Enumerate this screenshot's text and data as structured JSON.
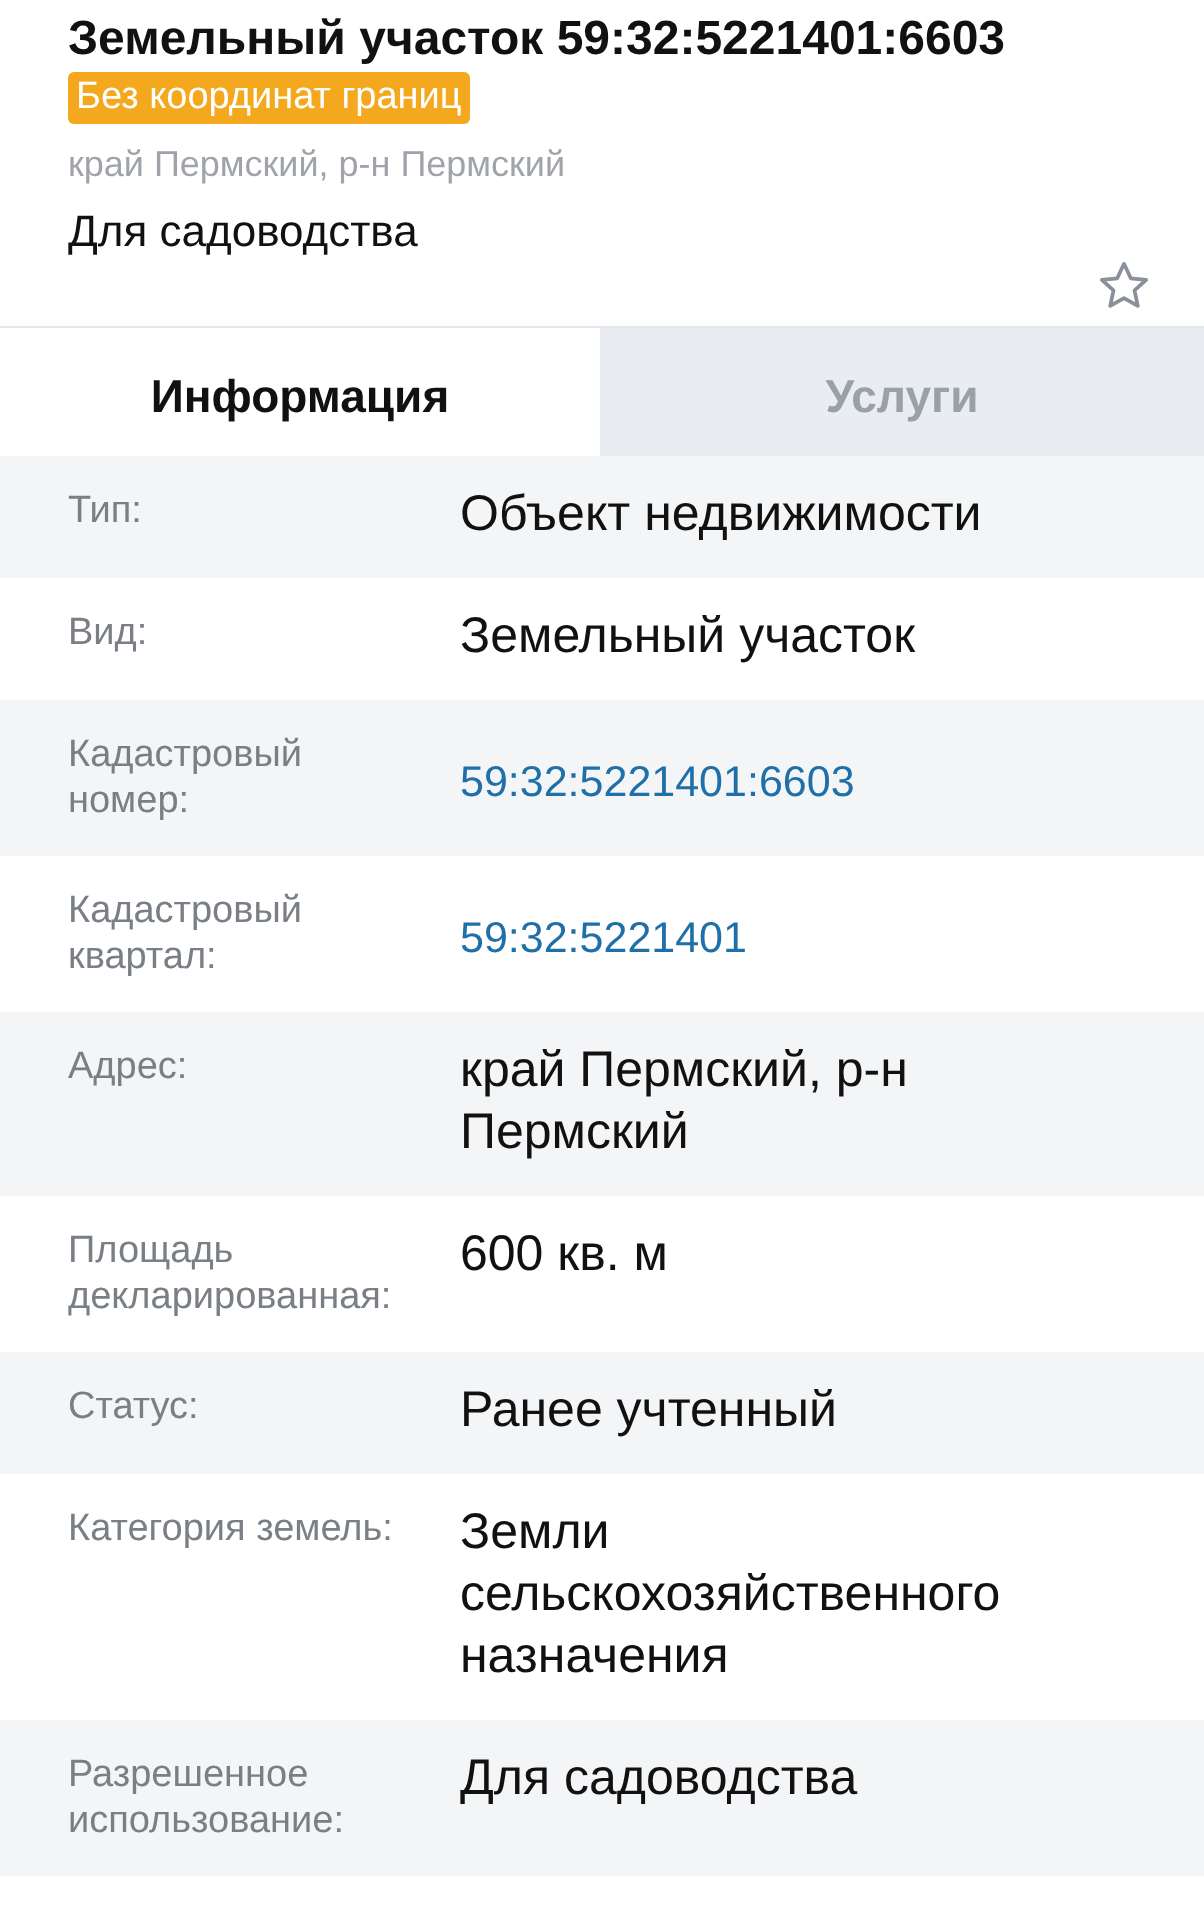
{
  "header": {
    "title": "Земельный участок 59:32:5221401:6603",
    "badge": "Без координат границ",
    "address": "край Пермский, р-н Пермский",
    "purpose": "Для садоводства",
    "favorite": false
  },
  "tabs": [
    {
      "label": "Информация",
      "selected": true
    },
    {
      "label": "Услуги",
      "selected": false
    }
  ],
  "rows": [
    {
      "label": "Тип:",
      "value": "Объект недвижимости",
      "kind": "text"
    },
    {
      "label": "Вид:",
      "value": "Земельный участок",
      "kind": "text"
    },
    {
      "label": "Кадастровый номер:",
      "value": "59:32:5221401:6603",
      "kind": "link"
    },
    {
      "label": "Кадастровый квартал:",
      "value": "59:32:5221401",
      "kind": "link"
    },
    {
      "label": "Адрес:",
      "value": "край Пермский, р-н Пермский",
      "kind": "text"
    },
    {
      "label": "Площадь декларированная:",
      "value": "600 кв. м",
      "kind": "text"
    },
    {
      "label": "Статус:",
      "value": "Ранее учтенный",
      "kind": "text"
    },
    {
      "label": "Категория земель:",
      "value": "Земли сельскохозяйственного назначения",
      "kind": "text"
    },
    {
      "label": "Разрешенное использование:",
      "value": "Для садоводства",
      "kind": "text"
    }
  ]
}
